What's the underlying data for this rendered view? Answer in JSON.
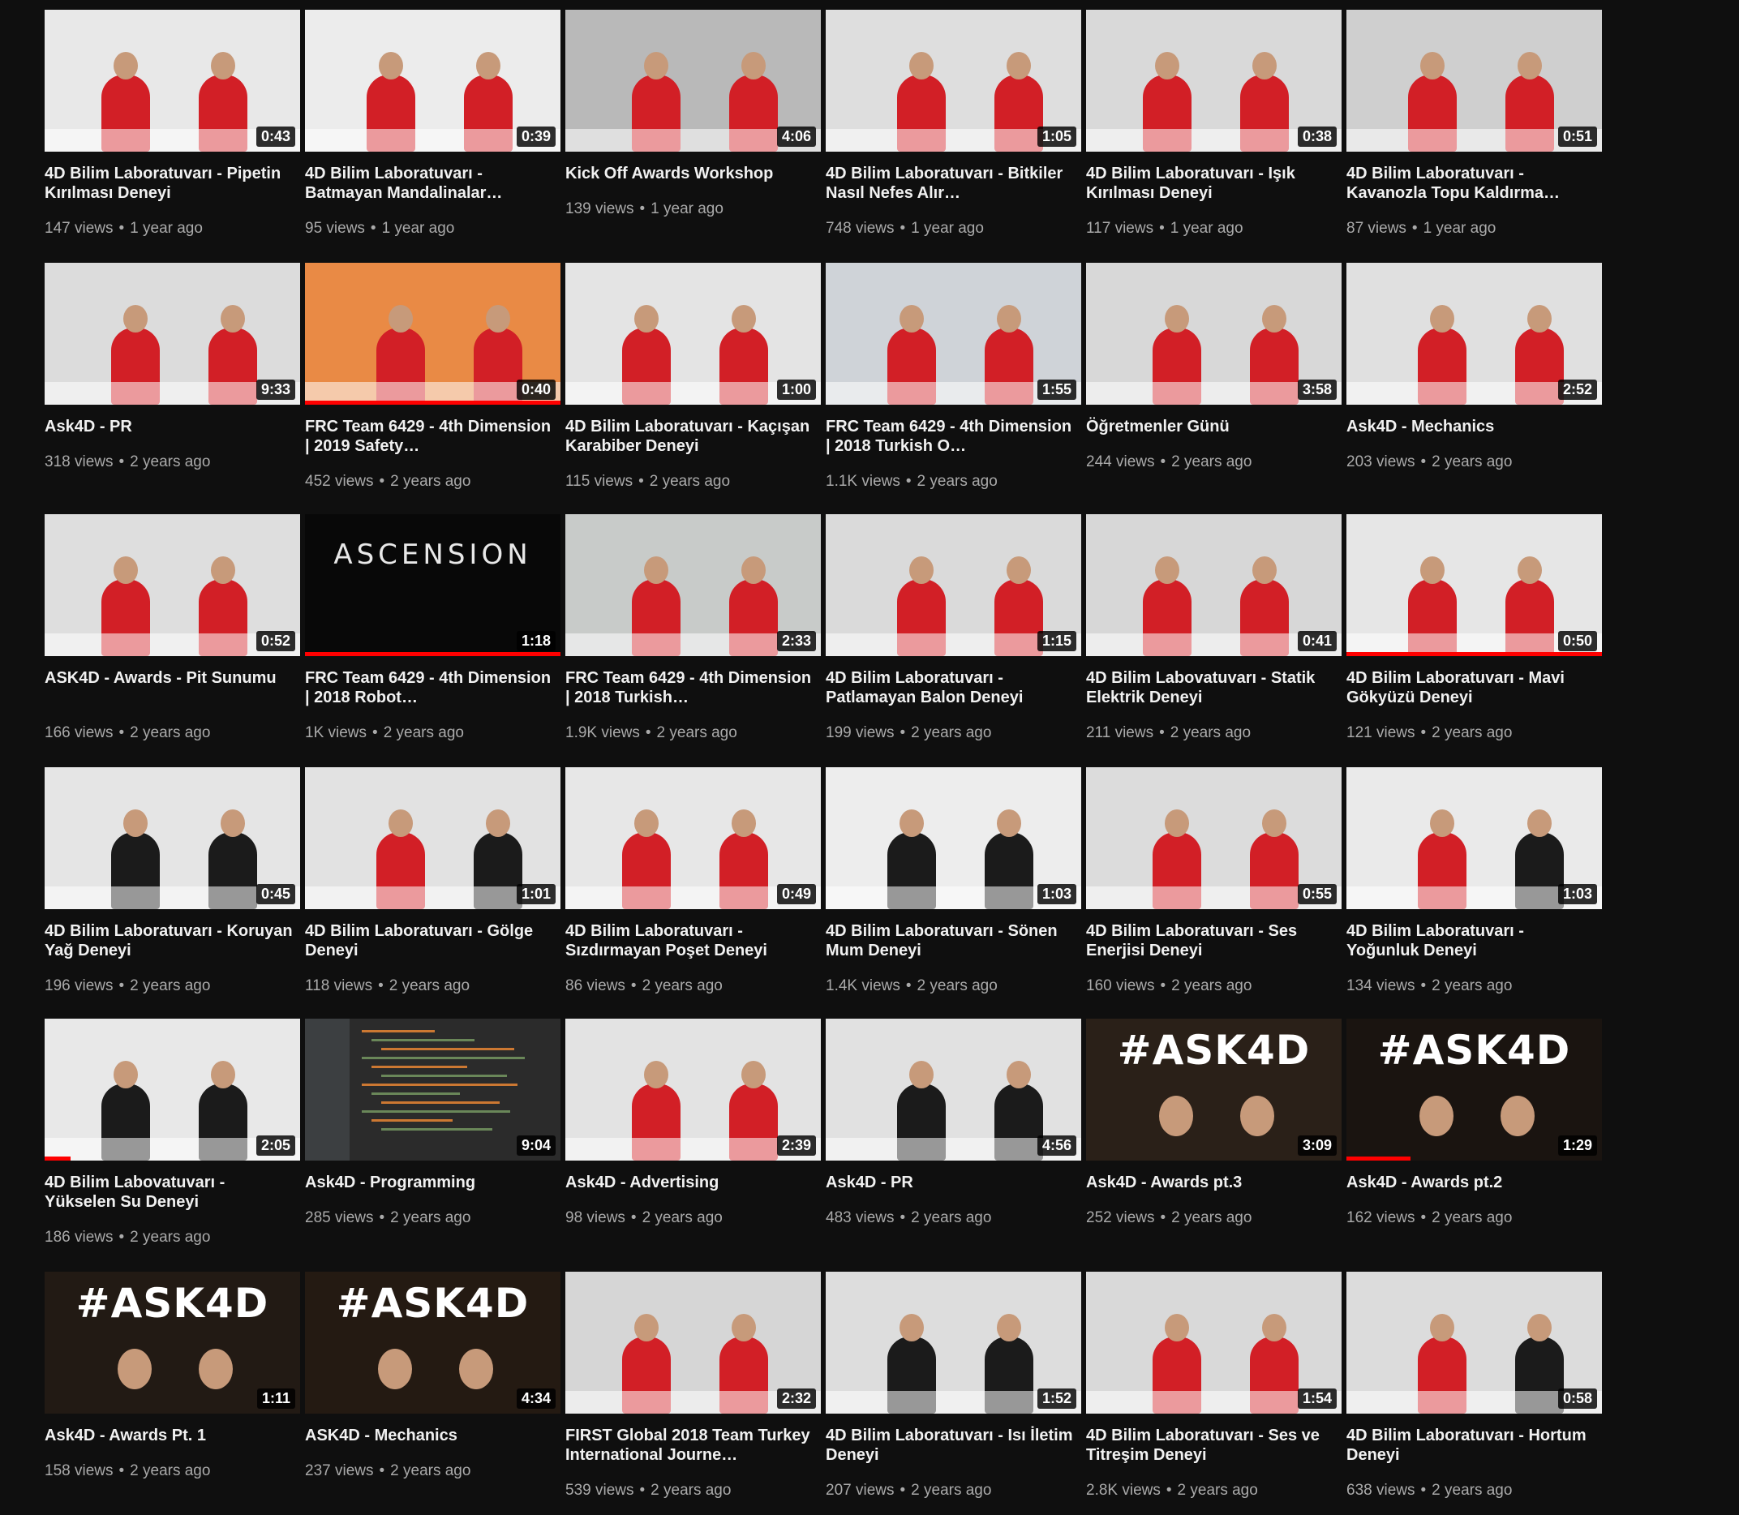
{
  "videos": [
    {
      "title": "4D Bilim Laboratuvarı - Pipetin Kırılması Deneyi",
      "views": "147 views",
      "age": "1 year ago",
      "duration": "0:43",
      "lines": 2,
      "progress": 0,
      "bg": "#e8e8e8"
    },
    {
      "title": "4D Bilim Laboratuvarı - Batmayan Mandalinalar…",
      "views": "95 views",
      "age": "1 year ago",
      "duration": "0:39",
      "lines": 2,
      "progress": 0,
      "bg": "#ececec"
    },
    {
      "title": "Kick Off Awards Workshop",
      "views": "139 views",
      "age": "1 year ago",
      "duration": "4:06",
      "lines": 1,
      "progress": 0,
      "bg": "#b9b9b9"
    },
    {
      "title": "4D Bilim Laboratuvarı - Bitkiler Nasıl Nefes Alır…",
      "views": "748 views",
      "age": "1 year ago",
      "duration": "1:05",
      "lines": 2,
      "progress": 0,
      "bg": "#dedede"
    },
    {
      "title": "4D Bilim Laboratuvarı - Işık Kırılması Deneyi",
      "views": "117 views",
      "age": "1 year ago",
      "duration": "0:38",
      "lines": 2,
      "progress": 0,
      "bg": "#d9d9d9"
    },
    {
      "title": "4D Bilim Laboratuvarı - Kavanozla Topu Kaldırma…",
      "views": "87 views",
      "age": "1 year ago",
      "duration": "0:51",
      "lines": 2,
      "progress": 0,
      "bg": "#cfcfcf"
    },
    {
      "title": "Ask4D - PR",
      "views": "318 views",
      "age": "2 years ago",
      "duration": "9:33",
      "lines": 1,
      "progress": 0,
      "bg": "#dcdcdc"
    },
    {
      "title": "FRC Team 6429 - 4th Dimension | 2019 Safety…",
      "views": "452 views",
      "age": "2 years ago",
      "duration": "0:40",
      "lines": 2,
      "progress": 1,
      "bg": "#e98a45"
    },
    {
      "title": "4D Bilim Laboratuvarı - Kaçışan Karabiber Deneyi",
      "views": "115 views",
      "age": "2 years ago",
      "duration": "1:00",
      "lines": 2,
      "progress": 0,
      "bg": "#e4e4e4"
    },
    {
      "title": "FRC Team 6429 - 4th Dimension | 2018 Turkish O…",
      "views": "1.1K views",
      "age": "2 years ago",
      "duration": "1:55",
      "lines": 2,
      "progress": 0,
      "bg": "#cfd3d8"
    },
    {
      "title": "Öğretmenler Günü",
      "views": "244 views",
      "age": "2 years ago",
      "duration": "3:58",
      "lines": 1,
      "progress": 0,
      "bg": "#d8d8d8"
    },
    {
      "title": "Ask4D - Mechanics",
      "views": "203 views",
      "age": "2 years ago",
      "duration": "2:52",
      "lines": 1,
      "progress": 0,
      "bg": "#e0e0e0"
    },
    {
      "title": "ASK4D - Awards - Pit Sunumu",
      "views": "166 views",
      "age": "2 years ago",
      "duration": "0:52",
      "lines": 2,
      "progress": 0,
      "bg": "#dedede"
    },
    {
      "title": "FRC Team 6429 - 4th Dimension | 2018 Robot…",
      "views": "1K views",
      "age": "2 years ago",
      "duration": "1:18",
      "lines": 2,
      "progress": 1,
      "bg": "#080808",
      "thin_text": "ASCENSION"
    },
    {
      "title": "FRC Team 6429 - 4th Dimension | 2018 Turkish…",
      "views": "1.9K views",
      "age": "2 years ago",
      "duration": "2:33",
      "lines": 2,
      "progress": 0,
      "bg": "#c8cbc9"
    },
    {
      "title": "4D Bilim Laboratuvarı - Patlamayan Balon Deneyi",
      "views": "199 views",
      "age": "2 years ago",
      "duration": "1:15",
      "lines": 2,
      "progress": 0,
      "bg": "#dadada"
    },
    {
      "title": "4D Bilim Labovatuvarı - Statik Elektrik Deneyi",
      "views": "211 views",
      "age": "2 years ago",
      "duration": "0:41",
      "lines": 2,
      "progress": 0,
      "bg": "#d7d7d7"
    },
    {
      "title": "4D Bilim Laboratuvarı - Mavi Gökyüzü Deneyi",
      "views": "121 views",
      "age": "2 years ago",
      "duration": "0:50",
      "lines": 2,
      "progress": 1,
      "bg": "#e6e6e6"
    },
    {
      "title": "4D Bilim Laboratuvarı - Koruyan Yağ Deneyi",
      "views": "196 views",
      "age": "2 years ago",
      "duration": "0:45",
      "lines": 2,
      "progress": 0,
      "bg": "#e5e5e5"
    },
    {
      "title": "4D Bilim Laboratuvarı - Gölge Deneyi",
      "views": "118 views",
      "age": "2 years ago",
      "duration": "1:01",
      "lines": 2,
      "progress": 0,
      "bg": "#e2e2e2"
    },
    {
      "title": "4D Bilim Laboratuvarı - Sızdırmayan Poşet Deneyi",
      "views": "86 views",
      "age": "2 years ago",
      "duration": "0:49",
      "lines": 2,
      "progress": 0,
      "bg": "#e7e7e7"
    },
    {
      "title": "4D Bilim Laboratuvarı - Sönen Mum Deneyi",
      "views": "1.4K views",
      "age": "2 years ago",
      "duration": "1:03",
      "lines": 2,
      "progress": 0,
      "bg": "#ededed"
    },
    {
      "title": "4D Bilim Laboratuvarı - Ses Enerjisi Deneyi",
      "views": "160 views",
      "age": "2 years ago",
      "duration": "0:55",
      "lines": 2,
      "progress": 0,
      "bg": "#dcdcdc"
    },
    {
      "title": "4D Bilim Laboratuvarı - Yoğunluk Deneyi",
      "views": "134 views",
      "age": "2 years ago",
      "duration": "1:03",
      "lines": 2,
      "progress": 0,
      "bg": "#eaeaea"
    },
    {
      "title": "4D Bilim Labovatuvarı - Yükselen Su Deneyi",
      "views": "186 views",
      "age": "2 years ago",
      "duration": "2:05",
      "lines": 2,
      "progress": 0.1,
      "bg": "#e8e8e8"
    },
    {
      "title": "Ask4D - Programming",
      "views": "285 views",
      "age": "2 years ago",
      "duration": "9:04",
      "lines": 1,
      "progress": 0,
      "bg": "#2b2b2b"
    },
    {
      "title": "Ask4D - Advertising",
      "views": "98 views",
      "age": "2 years ago",
      "duration": "2:39",
      "lines": 1,
      "progress": 0,
      "bg": "#e3e3e3"
    },
    {
      "title": "Ask4D - PR",
      "views": "483 views",
      "age": "2 years ago",
      "duration": "4:56",
      "lines": 1,
      "progress": 0,
      "bg": "#e1e1e1"
    },
    {
      "title": "Ask4D - Awards pt.3",
      "views": "252 views",
      "age": "2 years ago",
      "duration": "3:09",
      "lines": 1,
      "progress": 0,
      "bg": "#2a2018",
      "big_text": "#ASK4D"
    },
    {
      "title": "Ask4D - Awards pt.2",
      "views": "162 views",
      "age": "2 years ago",
      "duration": "1:29",
      "lines": 1,
      "progress": 0.25,
      "bg": "#1a1410",
      "big_text": "#ASK4D"
    },
    {
      "title": "Ask4D - Awards Pt. 1",
      "views": "158 views",
      "age": "2 years ago",
      "duration": "1:11",
      "lines": 1,
      "progress": 0,
      "bg": "#221a14",
      "big_text": "#ASK4D"
    },
    {
      "title": "ASK4D - Mechanics",
      "views": "237 views",
      "age": "2 years ago",
      "duration": "4:34",
      "lines": 1,
      "progress": 0,
      "bg": "#241a12",
      "big_text": "#ASK4D"
    },
    {
      "title": "FIRST Global 2018 Team Turkey International Journe…",
      "views": "539 views",
      "age": "2 years ago",
      "duration": "2:32",
      "lines": 2,
      "progress": 0,
      "bg": "#d6d6d6"
    },
    {
      "title": "4D Bilim Laboratuvarı - Isı İletim Deneyi",
      "views": "207 views",
      "age": "2 years ago",
      "duration": "1:52",
      "lines": 2,
      "progress": 0,
      "bg": "#dddddd"
    },
    {
      "title": "4D Bilim Laboratuvarı - Ses ve Titreşim Deneyi",
      "views": "2.8K views",
      "age": "2 years ago",
      "duration": "1:54",
      "lines": 2,
      "progress": 0,
      "bg": "#d9d9d9"
    },
    {
      "title": "4D Bilim Laboratuvarı - Hortum Deneyi",
      "views": "638 views",
      "age": "2 years ago",
      "duration": "0:58",
      "lines": 2,
      "progress": 0,
      "bg": "#dcdcdc"
    }
  ],
  "separator": "•",
  "colors": {
    "background": "#0f0f0f",
    "title": "#f1f1f1",
    "meta": "#aaaaaa",
    "progress": "#ff0000",
    "shirt_red": "#d21f26",
    "shirt_black": "#1b1b1b"
  }
}
